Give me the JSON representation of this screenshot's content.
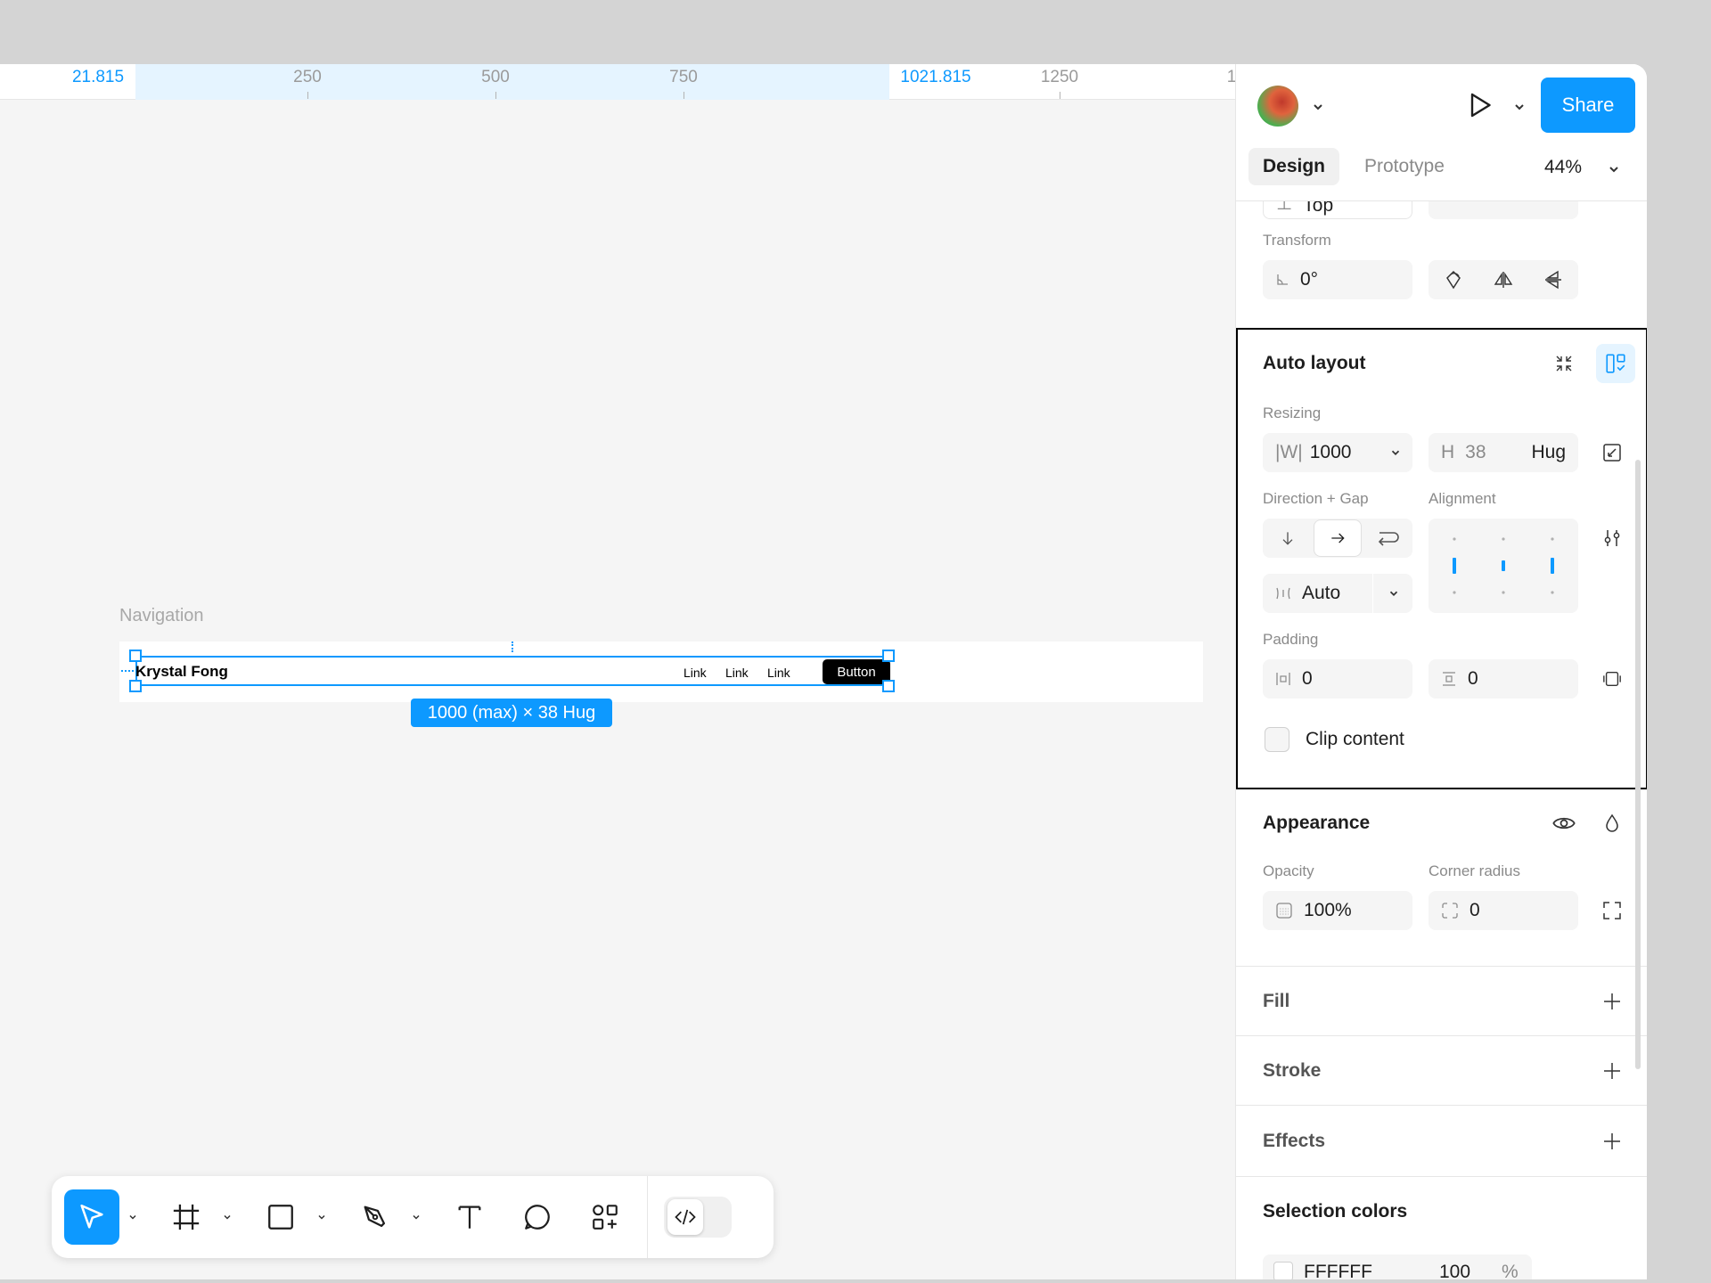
{
  "ruler": {
    "ticks": [
      "21.815",
      "250",
      "500",
      "750",
      "1021.815",
      "1250",
      "1"
    ]
  },
  "canvas": {
    "frame_label": "Navigation",
    "brand": "Krystal Fong",
    "links": [
      "Link",
      "Link",
      "Link"
    ],
    "button_label": "Button",
    "size_badge": "1000 (max) × 38 Hug"
  },
  "header": {
    "share_label": "Share",
    "tabs": [
      {
        "label": "Design"
      },
      {
        "label": "Prototype"
      }
    ],
    "zoom": "44%"
  },
  "panel": {
    "partial_top": "Top",
    "transform": {
      "label": "Transform",
      "rotation": "0°"
    },
    "auto_layout": {
      "title": "Auto layout",
      "resizing_label": "Resizing",
      "width_prefix": "|W|",
      "width_value": "1000",
      "height_prefix": "H",
      "height_value": "38",
      "height_mode": "Hug",
      "direction_label": "Direction + Gap",
      "alignment_label": "Alignment",
      "gap_value": "Auto",
      "padding_label": "Padding",
      "padding_horizontal": "0",
      "padding_vertical": "0",
      "clip_content_label": "Clip content"
    },
    "appearance": {
      "title": "Appearance",
      "opacity_label": "Opacity",
      "opacity_value": "100%",
      "corner_radius_label": "Corner radius",
      "corner_radius_value": "0"
    },
    "fill_label": "Fill",
    "stroke_label": "Stroke",
    "effects_label": "Effects",
    "selection_colors": {
      "title": "Selection colors",
      "color_hex": "FFFFFF",
      "color_opacity": "100",
      "percent_sign": "%"
    }
  },
  "colors": {
    "accent": "#0d99ff",
    "canvas_bg": "#f5f5f5"
  }
}
